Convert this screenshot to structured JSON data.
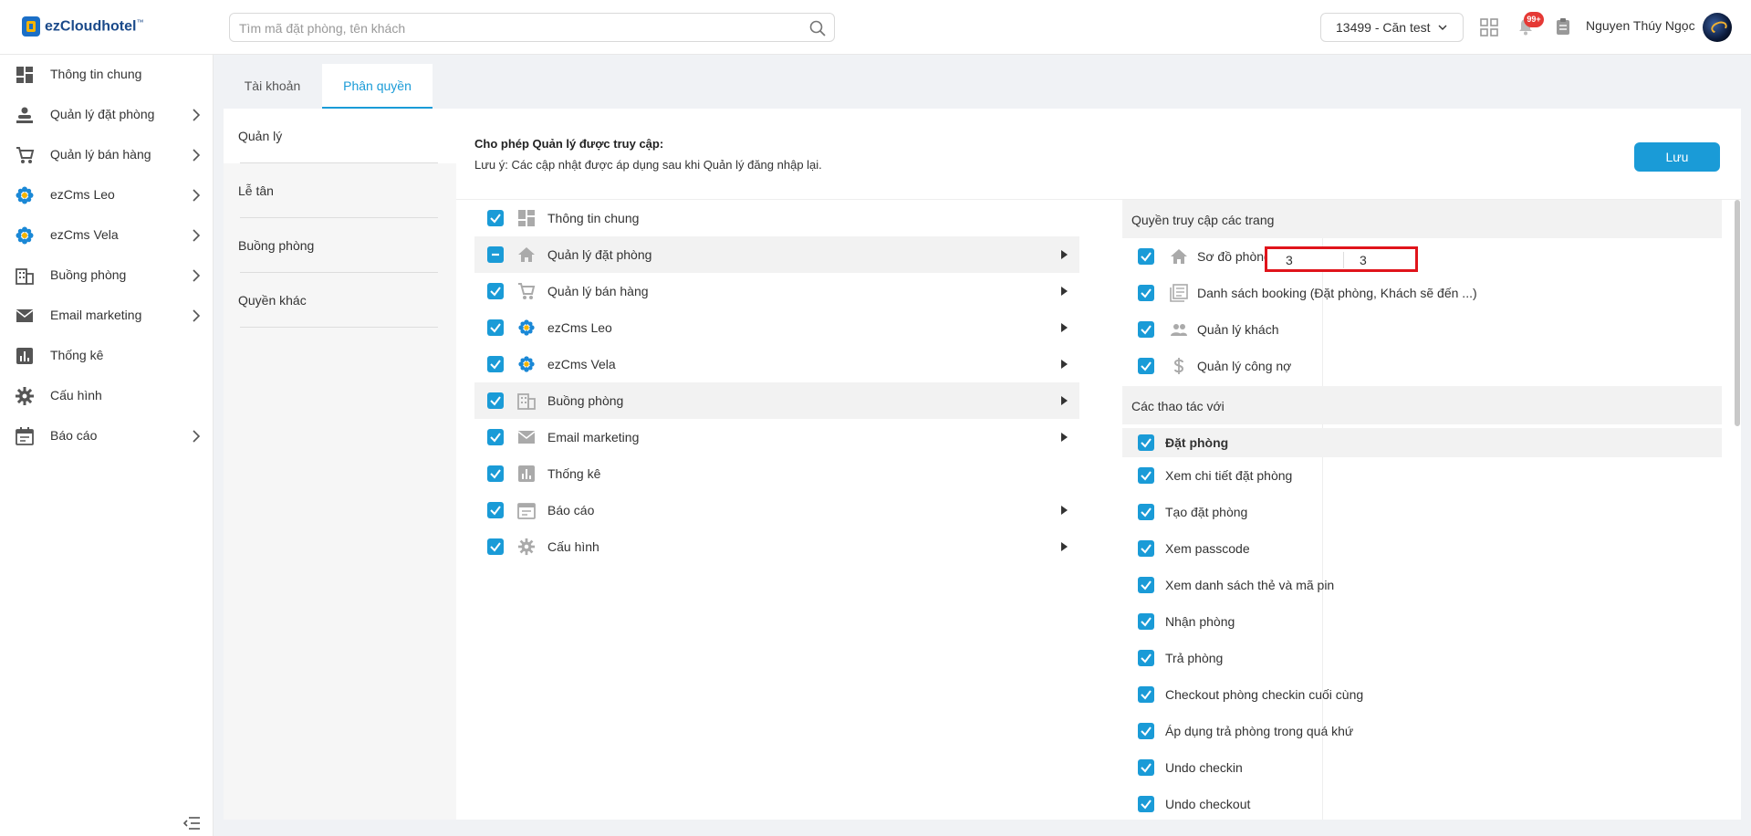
{
  "brand": {
    "name": "ezCloudhotel",
    "tm": "™"
  },
  "search": {
    "placeholder": "Tìm mã đặt phòng, tên khách"
  },
  "header": {
    "hotel": "13499 - Căn test",
    "notifications_badge": "99+",
    "user_name": "Nguyen Thúy Ngọc"
  },
  "sidebar": {
    "items": [
      {
        "label": "Thông tin chung",
        "icon": "dashboard-icon",
        "has_arrow": false
      },
      {
        "label": "Quản lý đặt phòng",
        "icon": "booking-icon",
        "has_arrow": true
      },
      {
        "label": "Quản lý bán hàng",
        "icon": "cart-icon",
        "has_arrow": true
      },
      {
        "label": "ezCms Leo",
        "icon": "flower-icon",
        "has_arrow": true
      },
      {
        "label": "ezCms Vela",
        "icon": "flower-icon",
        "has_arrow": true
      },
      {
        "label": "Buồng phòng",
        "icon": "building-icon",
        "has_arrow": true
      },
      {
        "label": "Email marketing",
        "icon": "mail-icon",
        "has_arrow": true
      },
      {
        "label": "Thống kê",
        "icon": "chart-icon",
        "has_arrow": false
      },
      {
        "label": "Cấu hình",
        "icon": "gear-icon",
        "has_arrow": false
      },
      {
        "label": "Báo cáo",
        "icon": "calendar-icon",
        "has_arrow": true
      }
    ]
  },
  "tabs": {
    "account": "Tài khoản",
    "permissions": "Phân quyền"
  },
  "roles": [
    "Quản lý",
    "Lễ tân",
    "Buồng phòng",
    "Quyền khác"
  ],
  "permission": {
    "title": "Cho phép Quản lý được truy cập:",
    "note": "Lưu ý: Các cập nhật được áp dụng sau khi Quản lý đăng nhập lại.",
    "save_label": "Lưu"
  },
  "modules": [
    {
      "label": "Thông tin chung",
      "icon": "dashboard-icon",
      "state": "checked",
      "arrow": false
    },
    {
      "label": "Quản lý đặt phòng",
      "icon": "home-icon",
      "state": "partial",
      "arrow": true
    },
    {
      "label": "Quản lý bán hàng",
      "icon": "cart-icon",
      "state": "checked",
      "arrow": true
    },
    {
      "label": "ezCms Leo",
      "icon": "flower-icon",
      "state": "checked",
      "arrow": true
    },
    {
      "label": "ezCms Vela",
      "icon": "flower-icon",
      "state": "checked",
      "arrow": true
    },
    {
      "label": "Buồng phòng",
      "icon": "building-icon",
      "state": "checked",
      "arrow": true
    },
    {
      "label": "Email marketing",
      "icon": "mail-icon",
      "state": "checked",
      "arrow": true
    },
    {
      "label": "Thống kê",
      "icon": "chart-icon",
      "state": "checked",
      "arrow": false
    },
    {
      "label": "Báo cáo",
      "icon": "calendar-icon",
      "state": "checked",
      "arrow": true
    },
    {
      "label": "Cấu hình",
      "icon": "gear-icon",
      "state": "checked",
      "arrow": true
    }
  ],
  "access": {
    "pages_title": "Quyền truy cập các trang",
    "pages": [
      {
        "label": "Sơ đồ phòng",
        "icon": "home-icon"
      },
      {
        "label": "Danh sách booking (Đặt phòng, Khách sẽ đến ...)",
        "icon": "list-icon"
      },
      {
        "label": "Quản lý khách",
        "icon": "people-icon"
      },
      {
        "label": "Quản lý công nợ",
        "icon": "dollar-icon"
      }
    ],
    "room_map_inputs": [
      "3",
      "3"
    ],
    "actions_title": "Các thao tác với",
    "action_group": "Đặt phòng",
    "actions": [
      "Xem chi tiết đặt phòng",
      "Tạo đặt phòng",
      "Xem passcode",
      "Xem danh sách thẻ và mã pin",
      "Nhận phòng",
      "Trả phòng",
      "Checkout phòng checkin cuối cùng",
      "Áp dụng trả phòng trong quá khứ",
      "Undo checkin",
      "Undo checkout"
    ]
  },
  "colors": {
    "accent": "#1a9bd7",
    "badge": "#e53935",
    "highlight_border": "#e0141b"
  }
}
